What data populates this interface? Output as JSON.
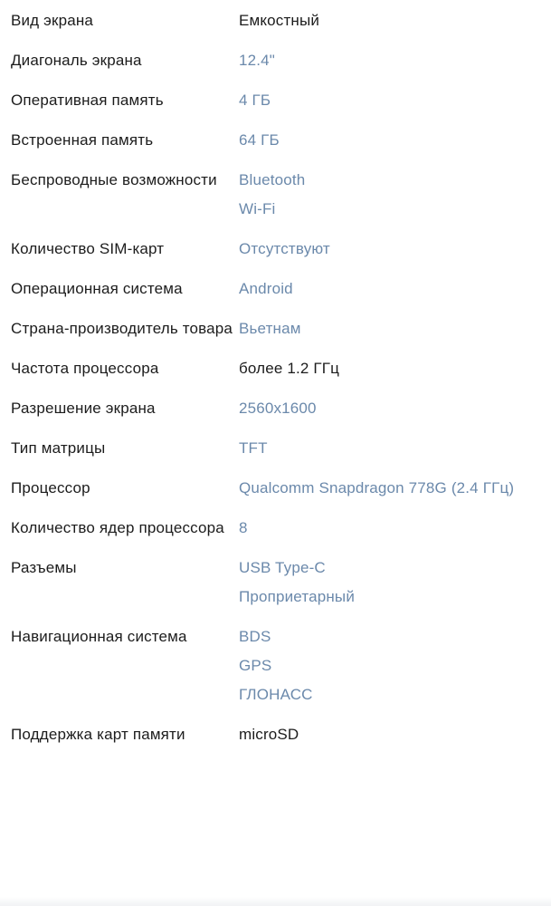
{
  "theme": {
    "background": "#ffffff",
    "label_color": "#1c1c1c",
    "link_color": "#6b89ab",
    "plain_value_color": "#1c1c1c"
  },
  "spec_table": {
    "rows": [
      {
        "label": "Вид экрана",
        "values": [
          {
            "text": "Емкостный",
            "style": "plain"
          }
        ]
      },
      {
        "label": "Диагональ экрана",
        "values": [
          {
            "text": "12.4\"",
            "style": "link"
          }
        ]
      },
      {
        "label": "Оперативная память",
        "values": [
          {
            "text": "4 ГБ",
            "style": "link"
          }
        ]
      },
      {
        "label": "Встроенная память",
        "values": [
          {
            "text": "64 ГБ",
            "style": "link"
          }
        ]
      },
      {
        "label": "Беспроводные возможности",
        "values": [
          {
            "text": "Bluetooth",
            "style": "link"
          },
          {
            "text": "Wi-Fi",
            "style": "link"
          }
        ]
      },
      {
        "label": "Количество SIM-карт",
        "values": [
          {
            "text": "Отсутствуют",
            "style": "link"
          }
        ]
      },
      {
        "label": "Операционная система",
        "values": [
          {
            "text": "Android",
            "style": "link"
          }
        ]
      },
      {
        "label": "Страна-производитель товара",
        "values": [
          {
            "text": "Вьетнам",
            "style": "link"
          }
        ]
      },
      {
        "label": "Частота процессора",
        "values": [
          {
            "text": "более 1.2 ГГц",
            "style": "plain"
          }
        ]
      },
      {
        "label": "Разрешение экрана",
        "values": [
          {
            "text": "2560x1600",
            "style": "link"
          }
        ]
      },
      {
        "label": "Тип матрицы",
        "values": [
          {
            "text": "TFT",
            "style": "link"
          }
        ]
      },
      {
        "label": "Процессор",
        "values": [
          {
            "text": "Qualcomm Snapdragon 778G (2.4 ГГц)",
            "style": "link"
          }
        ]
      },
      {
        "label": "Количество ядер процессора",
        "values": [
          {
            "text": "8",
            "style": "link"
          }
        ]
      },
      {
        "label": "Разъемы",
        "values": [
          {
            "text": "USB Type-C",
            "style": "link"
          },
          {
            "text": "Проприетарный",
            "style": "link"
          }
        ]
      },
      {
        "label": "Навигационная система",
        "values": [
          {
            "text": "BDS",
            "style": "link"
          },
          {
            "text": "GPS",
            "style": "link"
          },
          {
            "text": "ГЛОНАСС",
            "style": "link"
          }
        ]
      },
      {
        "label": "Поддержка карт памяти",
        "values": [
          {
            "text": "microSD",
            "style": "plain"
          }
        ]
      }
    ]
  }
}
